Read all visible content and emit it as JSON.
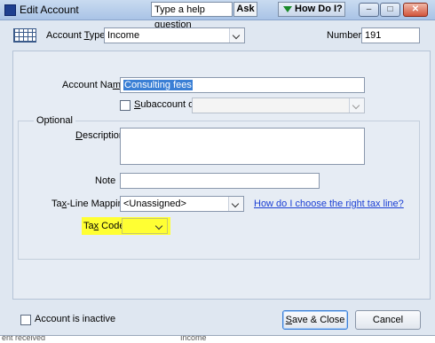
{
  "window": {
    "title": "Edit Account",
    "help_search_text": "Type a help question",
    "ask_label": "Ask",
    "how_do_i_label": "How Do I?",
    "min_glyph": "–",
    "max_glyph": "□",
    "close_glyph": "✕"
  },
  "account_type": {
    "label_pre": "Account ",
    "label_key": "T",
    "label_post": "ype",
    "value": "Income"
  },
  "number": {
    "label": "Number",
    "value": "191"
  },
  "account_name": {
    "label_pre": "Account Na",
    "label_key": "m",
    "label_post": "e",
    "value": "Consulting fees"
  },
  "subaccount": {
    "label_key": "S",
    "label_post": "ubaccount of",
    "checked": false,
    "value": ""
  },
  "optional": {
    "legend": "Optional",
    "description_label_key": "D",
    "description_label_post": "escription",
    "description_value": "",
    "note_label": "Note",
    "note_value": "",
    "tax_line_label_pre": "Ta",
    "tax_line_label_key": "x",
    "tax_line_label_post": "-Line Mapping",
    "tax_line_value": "<Unassigned>",
    "tax_line_help_link": "How do I choose the right tax line?",
    "tax_code_label_pre": "Ta",
    "tax_code_label_key": "x",
    "tax_code_label_post": " Code",
    "tax_code_value": ""
  },
  "footer": {
    "inactive_label": "Account is inactive",
    "inactive_checked": false,
    "save_close_label_key": "S",
    "save_close_label_post": "ave & Close",
    "cancel_label": "Cancel"
  },
  "background_strip": {
    "left_text": "ent received",
    "mid_text": "Income"
  },
  "colors": {
    "highlight": "#ffff33",
    "selection": "#3a7fd5",
    "link": "#1b3fd4"
  }
}
